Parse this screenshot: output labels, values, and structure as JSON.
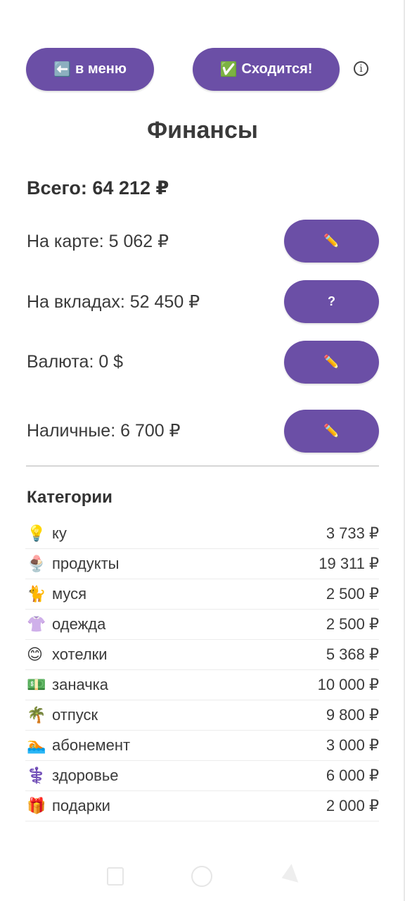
{
  "header": {
    "menu_icon": "⬅️",
    "menu_label": "в меню",
    "check_icon": "✅",
    "check_label": "Сходится!",
    "info_glyph": "i"
  },
  "page_title": "Финансы",
  "total": "Всего: 64 212 ₽",
  "accounts": [
    {
      "label": "На карте: 5 062 ₽",
      "button": "✏️"
    },
    {
      "label": "На вкладах: 52 450 ₽",
      "button": "?"
    },
    {
      "label": "Валюта: 0 $",
      "button": "✏️"
    },
    {
      "label": "Наличные: 6 700 ₽",
      "button": "✏️"
    }
  ],
  "categories_heading": "Категории",
  "categories": [
    {
      "emoji": "💡",
      "name": "ку",
      "amount": "3 733 ₽"
    },
    {
      "emoji": "🍨",
      "name": "продукты",
      "amount": "19 311 ₽"
    },
    {
      "emoji": "🐈",
      "name": "муся",
      "amount": "2 500 ₽"
    },
    {
      "emoji": "👚",
      "name": "одежда",
      "amount": "2 500 ₽"
    },
    {
      "emoji": "😊",
      "name": "хотелки",
      "amount": "5 368 ₽"
    },
    {
      "emoji": "💵",
      "name": "заначка",
      "amount": "10 000 ₽"
    },
    {
      "emoji": "🌴",
      "name": "отпуск",
      "amount": "9 800 ₽"
    },
    {
      "emoji": "🏊",
      "name": "абонемент",
      "amount": "3 000 ₽"
    },
    {
      "emoji": "⚕️",
      "name": "здоровье",
      "amount": "6 000 ₽"
    },
    {
      "emoji": "🎁",
      "name": "подарки",
      "amount": "2 000 ₽"
    }
  ],
  "colors": {
    "accent": "#6b4fa6",
    "text": "#3a3a3a",
    "divider": "#d6d6d6"
  }
}
